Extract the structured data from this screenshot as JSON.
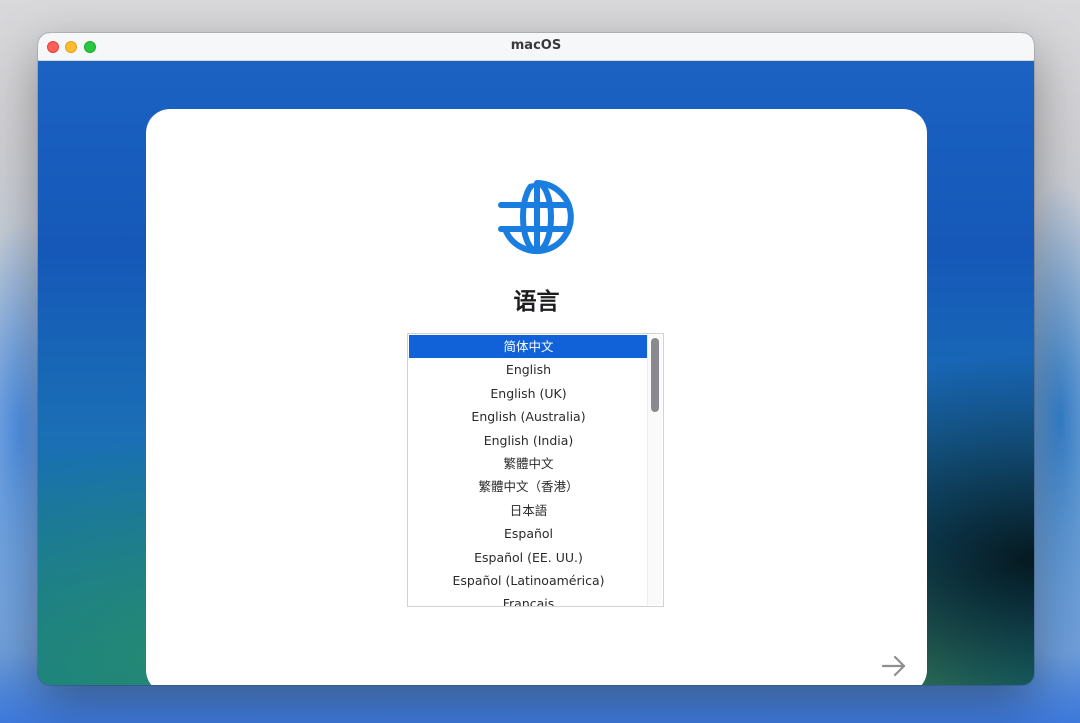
{
  "window": {
    "title": "macOS"
  },
  "panel": {
    "heading": "语言",
    "icon": "globe-icon",
    "next_icon": "arrow-right-icon"
  },
  "languages": {
    "selected_index": 0,
    "items": [
      "简体中文",
      "English",
      "English (UK)",
      "English (Australia)",
      "English (India)",
      "繁體中文",
      "繁體中文（香港）",
      "日本語",
      "Español",
      "Español (EE. UU.)",
      "Español (Latinoamérica)",
      "Français"
    ]
  },
  "colors": {
    "selection": "#1162d8",
    "globe": "#1a7ee0",
    "close": "#fe5f57",
    "minimize": "#febc2e",
    "zoom": "#28c840"
  }
}
